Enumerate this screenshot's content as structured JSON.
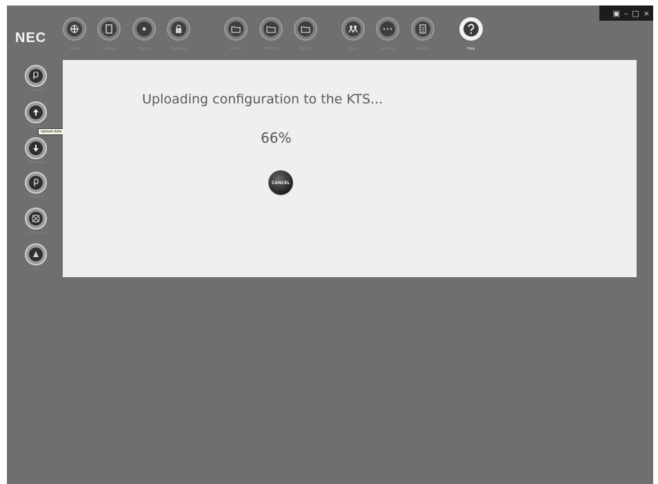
{
  "app": {
    "logo": "NEC",
    "window_controls": [
      "▣",
      "–",
      "□",
      "×"
    ]
  },
  "toolbar": {
    "items": [
      {
        "label": "Install",
        "icon": "crosshair-icon"
      },
      {
        "label": "Systems",
        "icon": "book-icon"
      },
      {
        "label": "Display",
        "icon": "disc-icon"
      },
      {
        "label": "Password",
        "icon": "lock-icon"
      },
      {
        "label": "Folder 1",
        "icon": "folder-icon"
      },
      {
        "label": "Folder 2",
        "icon": "folder-icon"
      },
      {
        "label": "Folder 3",
        "icon": "folder-icon"
      },
      {
        "label": "Users",
        "icon": "people-icon"
      },
      {
        "label": "Settings",
        "icon": "dots-icon"
      },
      {
        "label": "Reports",
        "icon": "document-icon"
      },
      {
        "label": "Help",
        "icon": "question-icon"
      }
    ]
  },
  "sidebar": {
    "items": [
      {
        "label": "Connect",
        "icon": "connect-icon"
      },
      {
        "label": "Upload",
        "icon": "upload-arrow-icon"
      },
      {
        "label": "Download",
        "icon": "download-arrow-icon"
      },
      {
        "label": "Program",
        "icon": "program-icon"
      },
      {
        "label": "Disconnect",
        "icon": "globe-icon"
      },
      {
        "label": "Sail",
        "icon": "sail-icon"
      }
    ],
    "tooltip": "Upload data to KTS"
  },
  "panel": {
    "message": "Uploading configuration to the KTS...",
    "progress_text": "66%",
    "progress": 0.66,
    "stop_label": "CANCEL"
  }
}
